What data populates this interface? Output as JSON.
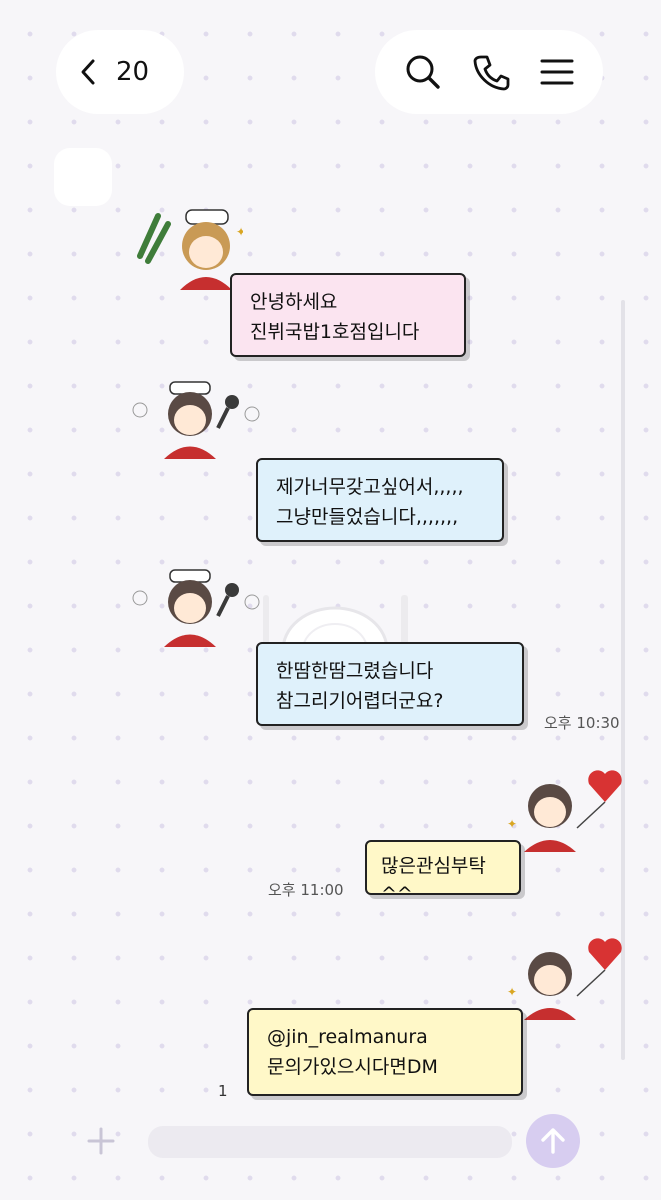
{
  "header": {
    "unread_count": "20",
    "icons": [
      "back-chevron-icon",
      "search-icon",
      "phone-icon",
      "menu-icon"
    ]
  },
  "messages": [
    {
      "side": "left",
      "text": "안녕하세요\n진뷔국밥1호점입니다",
      "color": "#fbe4f0"
    },
    {
      "side": "left",
      "text": "제가너무갖고싶어서,,,,,\n그냥만들었습니다,,,,,,,",
      "color": "#dff1fb"
    },
    {
      "side": "left",
      "text": "한땀한땀그렸습니다\n참그리기어렵더군요?",
      "color": "#dff1fb"
    },
    {
      "side": "right",
      "text": "많은관심부탁^^",
      "color": "#fff8c8"
    },
    {
      "side": "right",
      "text": "@jin_realmanura\n문의가있으시다면DM",
      "color": "#fff8c8"
    }
  ],
  "times": {
    "first": "오후 10:30",
    "second": "오후 11:00"
  },
  "read_count": "1",
  "input": {
    "placeholder": ""
  },
  "accent_color": "#d7cdf0"
}
